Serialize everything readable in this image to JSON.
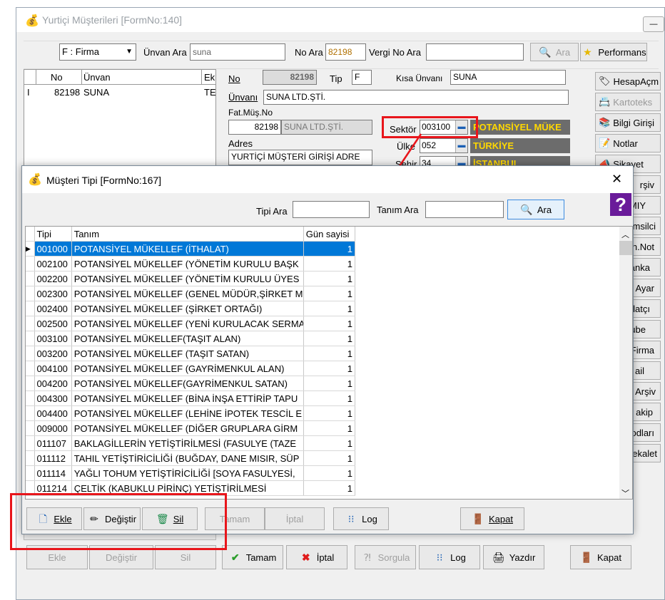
{
  "main_window": {
    "title": "Yurtiçi Müşterileri [FormNo:140]",
    "filter_combo": "F : Firma",
    "unvan_ara_label": "Ünvan Ara",
    "unvan_ara_value": "suna",
    "no_ara_label": "No Ara",
    "no_ara_value": "82198",
    "vergi_no_ara_label": "Vergi No Ara",
    "vergi_no_ara_value": "",
    "ara_button": "Ara",
    "performans_button": "Performans",
    "list_headers": [
      "No",
      "Ünvan",
      "Ek"
    ],
    "list_row": {
      "indicator": "I",
      "no": "82198",
      "unvan": "SUNA",
      "ek": "TE"
    },
    "no_label": "No",
    "no_value": "82198",
    "tip_label": "Tip",
    "tip_value": "F",
    "kisa_unvan_label": "Kısa Ünvanı",
    "kisa_unvan_value": "SUNA",
    "unvani_label": "Ünvanı",
    "unvani_value": "SUNA LTD.ŞTİ.",
    "fat_mus_no_label": "Fat.Müş.No",
    "fat_mus_no_value": "82198",
    "fat_mus_name": "SUNA LTD.ŞTİ.",
    "adres_label": "Adres",
    "adres_value": "YURTİÇİ MÜŞTERİ GİRİŞİ ADRE",
    "sektor_label": "Sektör",
    "sektor_code": "003100",
    "sektor_name": "POTANSİYEL MÜKE",
    "ulke_label": "Ülke",
    "ulke_code": "052",
    "ulke_name": "TÜRKİYE",
    "sehir_label": "Şehir",
    "sehir_code": "34",
    "sehir_name": "İSTANBUL",
    "side_buttons": [
      "HesapAçm",
      "Kartoteks",
      "Bilgi Girişi",
      "Notlar",
      "Şikayet",
      "rşiv",
      "MIY",
      "msilci",
      "n.Not",
      "anka",
      "Ayar",
      "alatçı",
      "ube",
      "Firma",
      "ail",
      "Arşiv",
      "akip",
      "odları",
      "ekalet"
    ],
    "bottom_buttons": {
      "ekle": "Ekle",
      "degistir": "Değiştir",
      "sil": "Sil",
      "tamam": "Tamam",
      "iptal": "İptal",
      "sorgula": "Sorgula",
      "log": "Log",
      "yazdir": "Yazdır",
      "kapat": "Kapat"
    },
    "minimize_glyph": "—"
  },
  "dialog": {
    "title": "Müşteri Tipi  [FormNo:167]",
    "close_glyph": "✕",
    "tipi_ara_label": "Tipi Ara",
    "tipi_ara_value": "",
    "tanim_ara_label": "Tanım Ara",
    "tanim_ara_value": "",
    "ara_button": "Ara",
    "help_glyph": "?",
    "headers": [
      "Tipi",
      "Tanım",
      "Gün sayisi"
    ],
    "rows": [
      {
        "tipi": "001000",
        "tanim": "POTANSİYEL MÜKELLEF (İTHALAT)",
        "gun": "1"
      },
      {
        "tipi": "002100",
        "tanim": "POTANSİYEL MÜKELLEF (YÖNETİM KURULU BAŞK",
        "gun": "1"
      },
      {
        "tipi": "002200",
        "tanim": "POTANSİYEL MÜKELLEF (YÖNETİM KURULU ÜYES",
        "gun": "1"
      },
      {
        "tipi": "002300",
        "tanim": "POTANSİYEL MÜKELLEF (GENEL MÜDÜR,ŞİRKET M",
        "gun": "1"
      },
      {
        "tipi": "002400",
        "tanim": "POTANSİYEL MÜKELLEF (ŞİRKET ORTAĞI)",
        "gun": "1"
      },
      {
        "tipi": "002500",
        "tanim": "POTANSİYEL MÜKELLEF (YENİ KURULACAK SERMA",
        "gun": "1"
      },
      {
        "tipi": "003100",
        "tanim": "POTANSİYEL MÜKELLEF(TAŞIT ALAN)",
        "gun": "1"
      },
      {
        "tipi": "003200",
        "tanim": "POTANSİYEL MÜKELLEF (TAŞIT SATAN)",
        "gun": "1"
      },
      {
        "tipi": "004100",
        "tanim": "POTANSİYEL MÜKELLEF (GAYRİMENKUL ALAN)",
        "gun": "1"
      },
      {
        "tipi": "004200",
        "tanim": "POTANSİYEL MÜKELLEF(GAYRİMENKUL SATAN)",
        "gun": "1"
      },
      {
        "tipi": "004300",
        "tanim": "POTANSİYEL MÜKELLEF (BİNA İNŞA ETTİRİP TAPU",
        "gun": "1"
      },
      {
        "tipi": "004400",
        "tanim": "POTANSİYEL MÜKELLEF (LEHİNE İPOTEK TESCİL E",
        "gun": "1"
      },
      {
        "tipi": "009000",
        "tanim": "POTANSİYEL MÜKELLEF (DİĞER GRUPLARA GİRM",
        "gun": "1"
      },
      {
        "tipi": "011107",
        "tanim": "BAKLAGİLLERİN YETİŞTİRİLMESİ (FASULYE (TAZE",
        "gun": "1"
      },
      {
        "tipi": "011112",
        "tanim": "TAHIL YETİŞTİRİCİLİĞİ (BUĞDAY, DANE MISIR, SÜP",
        "gun": "1"
      },
      {
        "tipi": "011114",
        "tanim": "YAĞLI TOHUM YETİŞTİRİCİLİĞİ [SOYA FASULYESİ, ",
        "gun": "1"
      },
      {
        "tipi": "011214",
        "tanim": "ÇELTİK (KABUKLU PİRİNÇ) YETİŞTİRİLMESİ",
        "gun": "1"
      }
    ],
    "buttons": {
      "ekle": "Ekle",
      "degistir": "Değiştir",
      "sil": "Sil",
      "tamam": "Tamam",
      "iptal": "İptal",
      "log": "Log",
      "kapat": "Kapat"
    }
  },
  "colors": {
    "highlight_red": "#e8151b",
    "selection_blue": "#0078d7",
    "sector_bg": "#6c6c6c",
    "sector_text": "#ffd800"
  }
}
